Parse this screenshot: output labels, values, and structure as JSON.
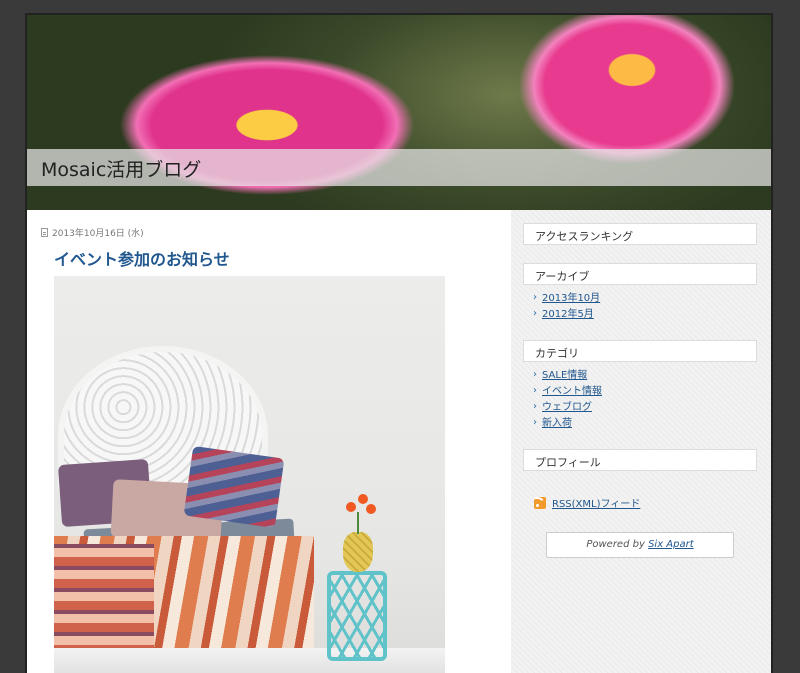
{
  "header": {
    "blog_title": "Mosaic活用ブログ"
  },
  "post": {
    "date": "2013年10月16日 (水)",
    "title": "イベント参加のお知らせ",
    "image_alt": "bedroom photo"
  },
  "sidebar": {
    "access_ranking": {
      "title": "アクセスランキング"
    },
    "archive": {
      "title": "アーカイブ",
      "items": [
        "2013年10月",
        "2012年5月"
      ]
    },
    "category": {
      "title": "カテゴリ",
      "items": [
        "SALE情報",
        "イベント情報",
        "ウェブログ",
        "新入荷"
      ]
    },
    "profile": {
      "title": "プロフィール"
    },
    "rss_label": "RSS(XML)フィード",
    "powered_prefix": "Powered by",
    "powered_link": "Six Apart"
  },
  "colors": {
    "link": "#21578f",
    "post_title": "#21578f",
    "frame": "#3a3a3a"
  },
  "icons": [
    "doc-icon",
    "rss-icon",
    "chevron-right-icon"
  ]
}
